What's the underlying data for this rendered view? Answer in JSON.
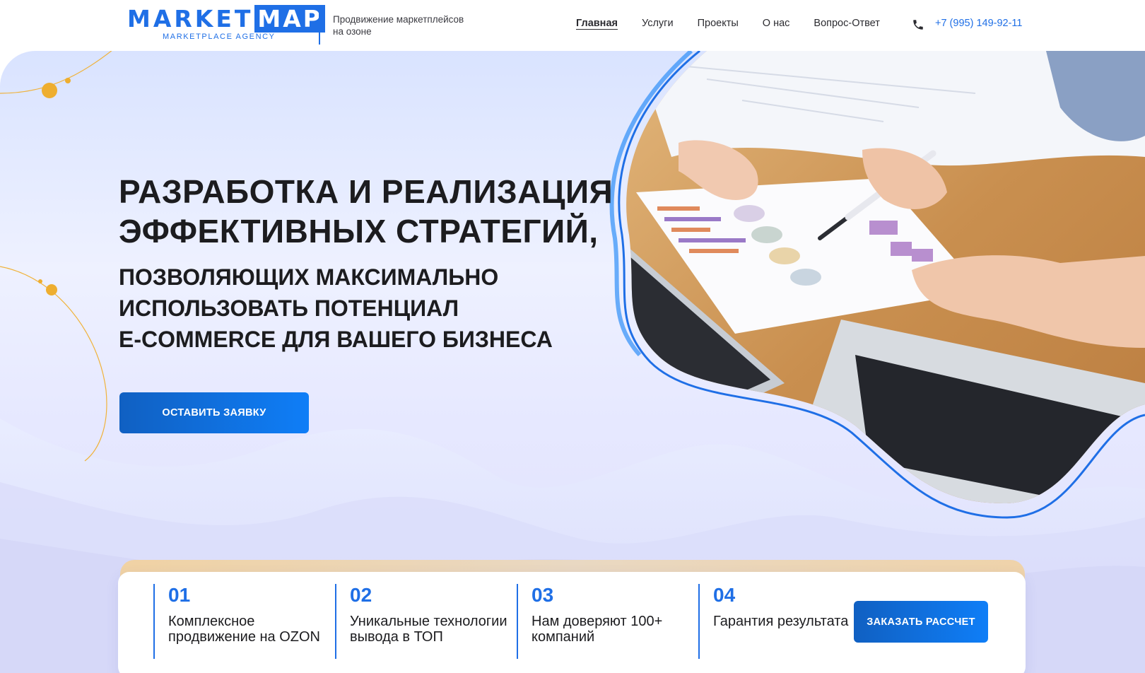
{
  "brand": {
    "logo_main": "MARKET",
    "logo_boxed": "MAP",
    "logo_sub": "MARKETPLACE AGENCY",
    "tagline": "Продвижение маркетплейсов на озоне",
    "accent_color": "#1f6fe6"
  },
  "nav": {
    "items": [
      {
        "label": "Главная",
        "active": true
      },
      {
        "label": "Услуги"
      },
      {
        "label": "Проекты"
      },
      {
        "label": "О нас"
      },
      {
        "label": "Вопрос-Ответ"
      }
    ],
    "phone": "+7 (995) 149-92-11",
    "phone_icon": "phone-icon"
  },
  "hero": {
    "title_line1": "РАЗРАБОТКА И РЕАЛИЗАЦИЯ",
    "title_line2": "ЭФФЕКТИВНЫХ СТРАТЕГИЙ,",
    "subtitle_line1": "ПОЗВОЛЯЮЩИХ МАКСИМАЛЬНО",
    "subtitle_line2": "ИСПОЛЬЗОВАТЬ ПОТЕНЦИАЛ",
    "subtitle_line3": "E-COMMERCE ДЛЯ ВАШЕГО БИЗНЕСА",
    "cta_label": "ОСТАВИТЬ ЗАЯВКУ"
  },
  "features": {
    "items": [
      {
        "num": "01",
        "text": "Комплексное продвижение на OZON"
      },
      {
        "num": "02",
        "text": "Уникальные технологии вывода в ТОП"
      },
      {
        "num": "03",
        "text": "Нам доверяют 100+ компаний"
      },
      {
        "num": "04",
        "text": "Гарантия результата"
      }
    ],
    "order_label": "ЗАКАЗАТЬ РАССЧЕТ"
  }
}
